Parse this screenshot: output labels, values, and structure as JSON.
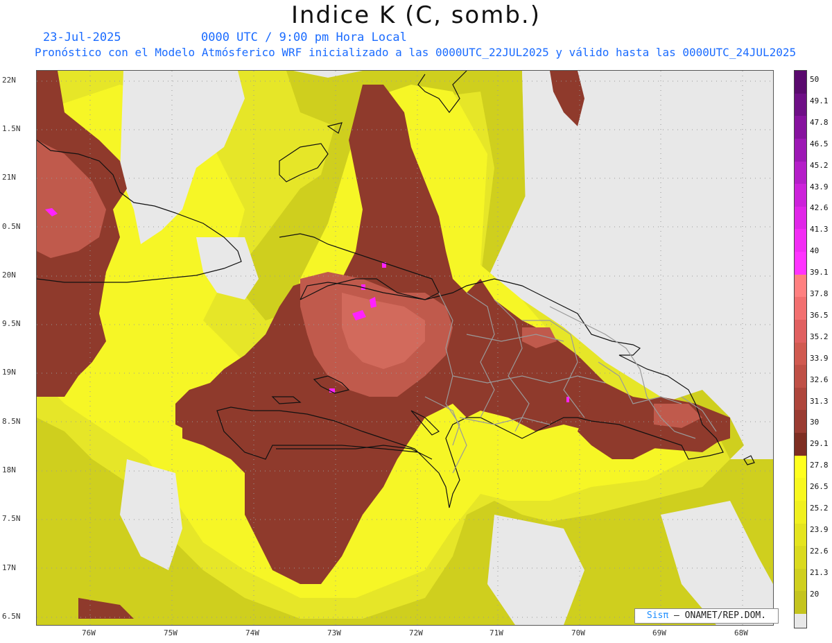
{
  "header": {
    "title": "Indice K (C, somb.)",
    "date": "23-Jul-2025",
    "time": "0000 UTC / 9:00 pm Hora Local",
    "description": "Pronóstico con el Modelo Atmósferico WRF inicializado a las 0000UTC_22JUL2025 y válido hasta las  0000UTC_24JUL2025"
  },
  "axes": {
    "lat_labels": [
      "22N",
      "1.5N",
      "21N",
      "0.5N",
      "20N",
      "9.5N",
      "19N",
      "8.5N",
      "18N",
      "7.5N",
      "17N",
      "6.5N"
    ],
    "lon_labels": [
      "76W",
      "75W",
      "74W",
      "73W",
      "72W",
      "71W",
      "70W",
      "69W",
      "68W"
    ]
  },
  "colorbar": {
    "labels": [
      "50",
      "49.1",
      "47.8",
      "46.5",
      "45.2",
      "43.9",
      "42.6",
      "41.3",
      "40",
      "39.1",
      "37.8",
      "36.5",
      "35.2",
      "33.9",
      "32.6",
      "31.3",
      "30",
      "29.1",
      "27.8",
      "26.5",
      "25.2",
      "23.9",
      "22.6",
      "21.3",
      "20"
    ],
    "colors": [
      "#5a0a6e",
      "#6e0f86",
      "#86129e",
      "#9c18b4",
      "#b41ec8",
      "#cc22da",
      "#e026e8",
      "#f22cf4",
      "#ff33ff",
      "#ff8080",
      "#f27070",
      "#e06060",
      "#d05a50",
      "#bf5046",
      "#ae463c",
      "#9a3c32",
      "#7e2e22",
      "#ffff1e",
      "#f8f81e",
      "#f0f01e",
      "#e4e41e",
      "#dada1e",
      "#cfcf1e",
      "#c4c41e",
      "#bcbc1e"
    ],
    "fill_colors": {
      "yellow_low": "#c8c81e",
      "yellow_mid": "#e6e628",
      "yellow_high": "#ffff2a",
      "brown_low": "#8f3a2c",
      "brown_mid": "#a84a3c",
      "pink": "#e46c6c",
      "magenta": "#ff22ff",
      "no_data": "#e8e8e8"
    }
  },
  "credit": {
    "brand": "Sisπ",
    "text": " – ONAMET/REP.DOM."
  }
}
